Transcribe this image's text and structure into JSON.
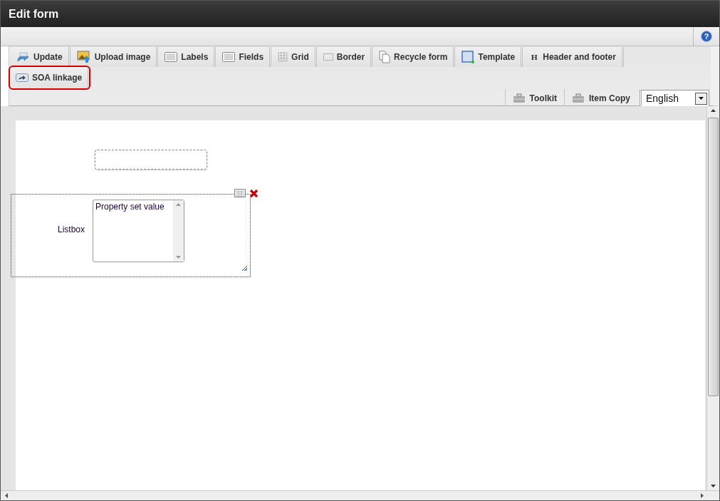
{
  "window": {
    "title": "Edit form"
  },
  "help": {
    "glyph": "?"
  },
  "toolbar": {
    "tabs": [
      {
        "label": "Update",
        "highlighted": false
      },
      {
        "label": "Upload image",
        "highlighted": false
      },
      {
        "label": "Labels",
        "highlighted": false
      },
      {
        "label": "Fields",
        "highlighted": false
      },
      {
        "label": "Grid",
        "highlighted": false
      },
      {
        "label": "Border",
        "highlighted": false
      },
      {
        "label": "Recycle form",
        "highlighted": false
      },
      {
        "label": "Template",
        "highlighted": false
      },
      {
        "label": "Header and footer",
        "glyph": "H",
        "highlighted": false
      },
      {
        "label": "SOA linkage",
        "highlighted": true
      }
    ],
    "tools": [
      "Toolkit",
      "Item Copy"
    ],
    "language": {
      "value": "English"
    }
  },
  "canvas": {
    "items": [
      {
        "kind": "field"
      },
      {
        "kind": "listbox",
        "label": "Listbox",
        "options": [
          "Property set value"
        ],
        "selected": true
      }
    ]
  }
}
